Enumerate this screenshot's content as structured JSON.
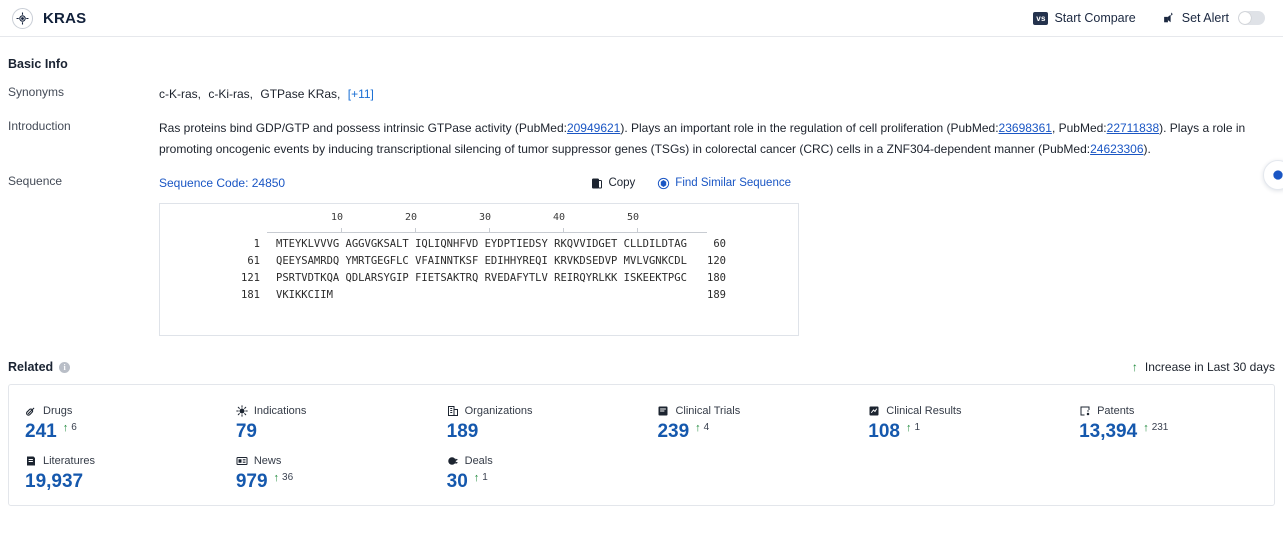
{
  "header": {
    "title": "KRAS",
    "brand_icon": "target-icon",
    "start_compare": "Start Compare",
    "vs_badge": "vs",
    "set_alert": "Set Alert",
    "alert_toggle_state": "off"
  },
  "basic_info": {
    "section_title": "Basic Info",
    "synonyms_label": "Synonyms",
    "synonyms": [
      "c-K-ras,",
      "c-Ki-ras,",
      "GTPase KRas,"
    ],
    "synonyms_more": "[+11]",
    "introduction_label": "Introduction",
    "introduction": {
      "p1a": "Ras proteins bind GDP/GTP and possess intrinsic GTPase activity (PubMed:",
      "pm1": "20949621",
      "p1b": "). Plays an important role in the regulation of cell proliferation (PubMed:",
      "pm2": "23698361",
      "p1c": ", PubMed:",
      "pm3": "22711838",
      "p1d": "). Plays a role in promoting oncogenic events by inducing transcriptional silencing of tumor suppressor genes (TSGs) in colorectal cancer (CRC) cells in a ZNF304-dependent manner (PubMed:",
      "pm4": "24623306",
      "p1e": ")."
    },
    "sequence_label": "Sequence",
    "sequence_code": "Sequence Code: 24850",
    "copy_label": "Copy",
    "find_similar_label": "Find Similar Sequence"
  },
  "sequence": {
    "ruler_ticks": [
      "10",
      "20",
      "30",
      "40",
      "50"
    ],
    "lines": [
      {
        "start": "1",
        "residues": "MTEYKLVVVG AGGVGKSALT IQLIQNHFVD EYDPTIEDSY RKQVVIDGET CLLDILDTAG",
        "end": "60"
      },
      {
        "start": "61",
        "residues": "QEEYSAMRDQ YMRTGEGFLC VFAINNTKSF EDIHHYREQI KRVKDSEDVP MVLVGNKCDL",
        "end": "120"
      },
      {
        "start": "121",
        "residues": "PSRTVDTKQA QDLARSYGIP FIETSAKTRQ RVEDAFYTLV REIRQYRLKK ISKEEKTPGC",
        "end": "180"
      },
      {
        "start": "181",
        "residues": "VKIKKCIIM",
        "end": "189"
      }
    ]
  },
  "related": {
    "title": "Related",
    "info_icon": "info-icon",
    "legend": "Increase in Last 30 days",
    "cards": [
      {
        "icon": "capsule-icon",
        "label": "Drugs",
        "value": "241",
        "delta": "6"
      },
      {
        "icon": "virus-icon",
        "label": "Indications",
        "value": "79",
        "delta": ""
      },
      {
        "icon": "building-icon",
        "label": "Organizations",
        "value": "189",
        "delta": ""
      },
      {
        "icon": "clipboard-icon",
        "label": "Clinical Trials",
        "value": "239",
        "delta": "4"
      },
      {
        "icon": "results-icon",
        "label": "Clinical Results",
        "value": "108",
        "delta": "1"
      },
      {
        "icon": "patent-icon",
        "label": "Patents",
        "value": "13,394",
        "delta": "231"
      },
      {
        "icon": "book-icon",
        "label": "Literatures",
        "value": "19,937",
        "delta": ""
      },
      {
        "icon": "news-icon",
        "label": "News",
        "value": "979",
        "delta": "36"
      },
      {
        "icon": "deal-icon",
        "label": "Deals",
        "value": "30",
        "delta": "1"
      }
    ]
  },
  "colors": {
    "accent_blue": "#1558ad",
    "link_blue": "#1a56c4",
    "increase_green": "#1f8a3c",
    "header_dark": "#11203a"
  }
}
